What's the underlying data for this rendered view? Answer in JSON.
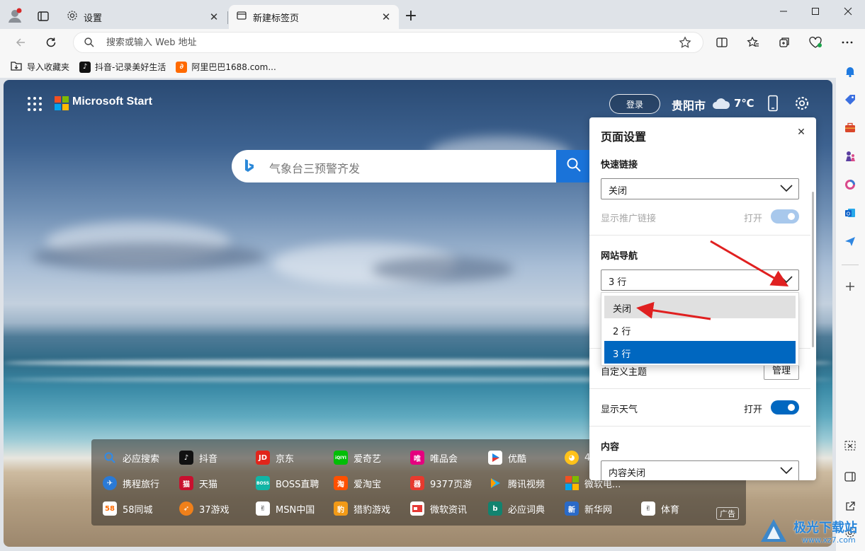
{
  "browser": {
    "tabs": [
      {
        "title": "设置",
        "active": false
      },
      {
        "title": "新建标签页",
        "active": true
      }
    ],
    "address_placeholder": "搜索或输入 Web 地址",
    "bookmarks": [
      {
        "label": "导入收藏夹"
      },
      {
        "label": "抖音-记录美好生活"
      },
      {
        "label": "阿里巴巴1688.com..."
      }
    ]
  },
  "newtab": {
    "brand": "Microsoft Start",
    "login_label": "登录",
    "city": "贵阳市",
    "temperature": "7℃",
    "search_placeholder": "气象台三预警齐发",
    "ad_label": "广告",
    "quick_links": [
      [
        "必应搜索",
        "抖音",
        "京东",
        "爱奇艺",
        "唯品会",
        "优酷",
        "4"
      ],
      [
        "携程旅行",
        "天猫",
        "BOSS直聘",
        "爱淘宝",
        "9377页游",
        "腾讯视频",
        "微软电..."
      ],
      [
        "58同城",
        "37游戏",
        "MSN中国",
        "猎豹游戏",
        "微软资讯",
        "必应词典",
        "新华网",
        "体育"
      ]
    ]
  },
  "settings_panel": {
    "title": "页面设置",
    "quick_links_label": "快速链接",
    "quick_links_value": "关闭",
    "promo_label": "显示推广链接",
    "promo_toggle_text": "打开",
    "nav_label": "网站导航",
    "nav_value": "3 行",
    "nav_options": [
      "关闭",
      "2 行",
      "3 行"
    ],
    "nav_selected_option": "3 行",
    "nav_hover_option": "关闭",
    "theme_label": "自定义主题",
    "manage_label": "管理",
    "weather_label": "显示天气",
    "weather_toggle_text": "打开",
    "content_label": "内容",
    "content_value": "内容关闭"
  },
  "watermark": {
    "text": "极光下载站",
    "sub": "www.xz7.com"
  },
  "colors": {
    "accent": "#0067c0",
    "toggle_on": "#0067c0",
    "toggle_disabled": "#a8c8ec",
    "annotation": "#e02020"
  }
}
